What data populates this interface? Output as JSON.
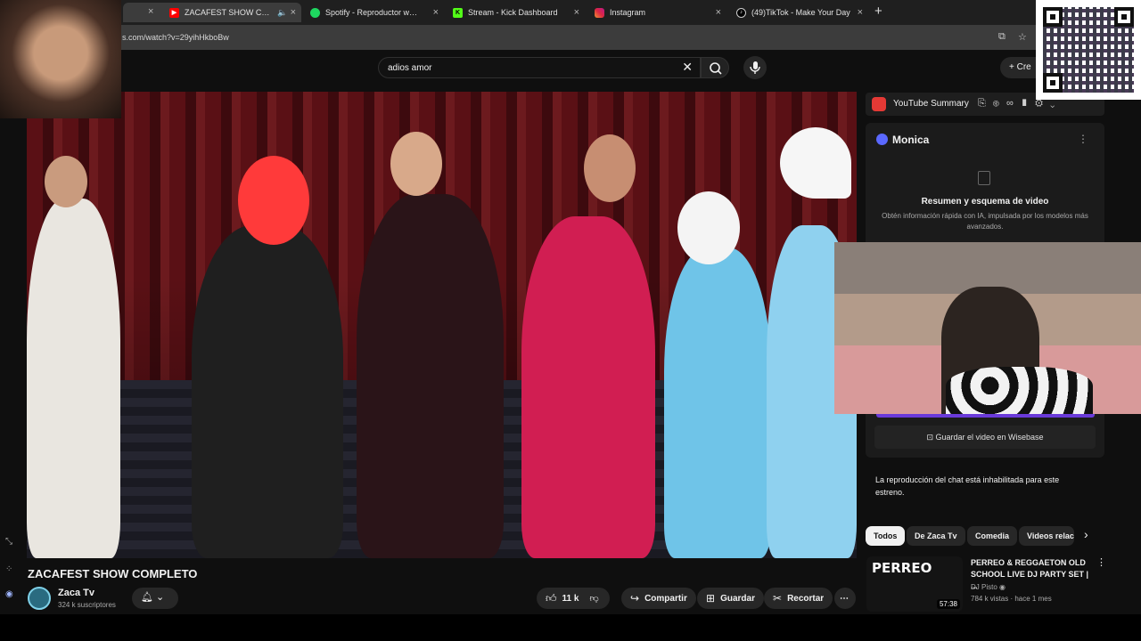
{
  "browser": {
    "tabs": [
      {
        "title": "ZACAFEST SHOW COMPLETO",
        "favicon": "youtube-icon",
        "color": "#ff0000",
        "active": true
      },
      {
        "title": "Spotify - Reproductor web: mú",
        "favicon": "spotify-icon",
        "color": "#1ed760"
      },
      {
        "title": "Stream - Kick Dashboard",
        "favicon": "kick-icon",
        "color": "#53fc18"
      },
      {
        "title": "Instagram",
        "favicon": "instagram-icon",
        "color": "#e1306c"
      },
      {
        "title": "(49)TikTok - Make Your Day",
        "favicon": "tiktok-icon",
        "color": "#ffffff"
      }
    ],
    "first_tab_close": "×",
    "new_tab": "+",
    "url": "s.com/watch?v=29yihHkboBw"
  },
  "header": {
    "search_value": "adios amor",
    "create_label": "Cre"
  },
  "video": {
    "title": "ZACAFEST SHOW COMPLETO",
    "channel": "Zaca Tv",
    "subscribers": "324 k suscriptores",
    "likes": "11 k",
    "share_label": "Compartir",
    "save_label": "Guardar",
    "clip_label": "Recortar"
  },
  "sidebar": {
    "summary_label": "YouTube Summary",
    "monica": {
      "name": "Monica",
      "title": "Resumen y esquema de video",
      "description": "Obtén información rápida con IA, impulsada por los modelos más avanzados.",
      "save_label": "Guardar el video en Wisebase"
    },
    "chat_note": "La reproducción del chat está inhabilitada para este estreno.",
    "chips": [
      "Todos",
      "De Zaca Tv",
      "Comedia",
      "Videos relac"
    ],
    "recommendation": {
      "thumb_text": "PERREO",
      "duration": "57:38",
      "title": "PERREO & REGGAETON OLD SCHOOL LIVE DJ PARTY SET | ...",
      "channel": "DJ Pisto",
      "meta": "784 k vistas · hace 1 mes"
    }
  },
  "colors": {
    "accent": "#ff0000",
    "background": "#0f0f0f",
    "chip_active": "#f1f1f1",
    "monica_purple": "#6a3ad9"
  }
}
